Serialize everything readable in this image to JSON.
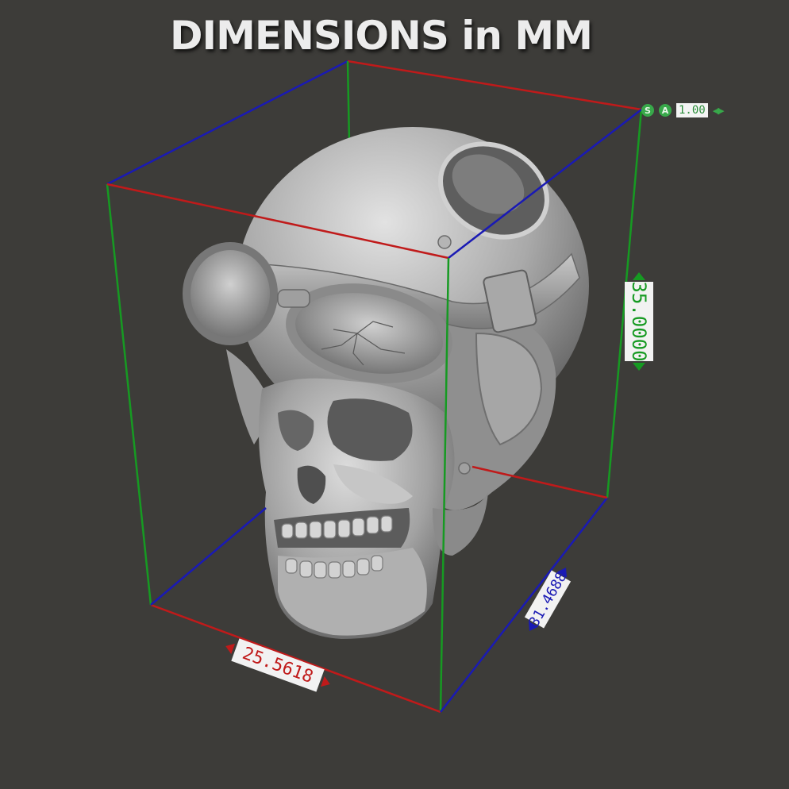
{
  "title": "DIMENSIONS in MM",
  "dimensions": {
    "width": "25.5618",
    "depth": "31.4688",
    "height": "35.0000"
  },
  "hud": {
    "snap_icon": "S",
    "axis_icon": "A",
    "scale_value": "1.00",
    "arrows": "◀▶"
  },
  "colors": {
    "background": "#3d3c39",
    "x_axis": "#c01a1a",
    "y_axis": "#1a1ab4",
    "z_axis": "#169a22",
    "model": "#b9b9b9"
  }
}
